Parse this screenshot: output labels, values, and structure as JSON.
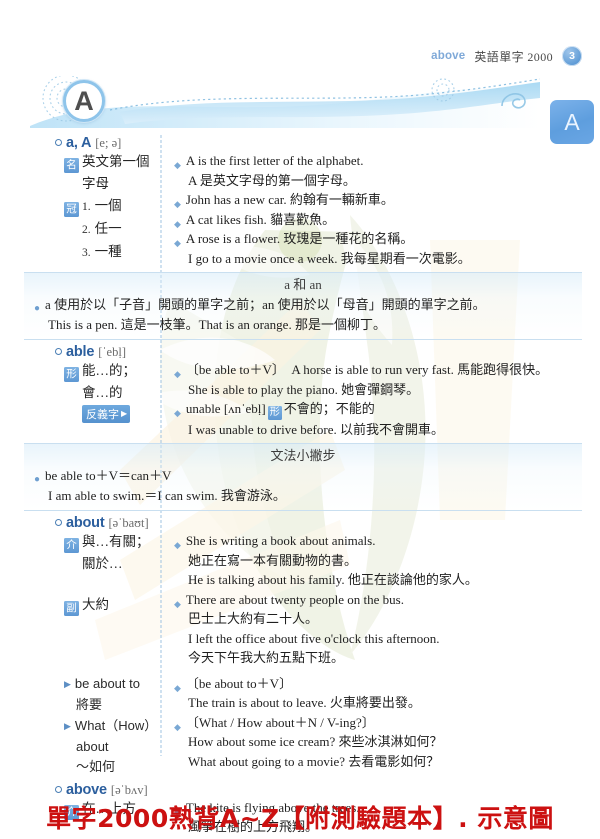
{
  "header": {
    "running_word": "above",
    "book_title": "英語單字 2000",
    "page_number": "3"
  },
  "thumb_tab": {
    "letter": "A"
  },
  "banner": {
    "letter": "A"
  },
  "colors": {
    "headword": "#2c5f9e",
    "pos_badge": "#5d97d3",
    "accent_blue": "#7aa8d4",
    "footer_red": "#cc1111"
  },
  "entries": [
    {
      "headword": "a, A",
      "phonetic": "[e; ə]",
      "senses": [
        {
          "pos": "名",
          "def_lines": [
            "英文第一個",
            "字母"
          ],
          "examples": [
            {
              "en": "A is the first letter of the alphabet.",
              "zh": "A 是英文字母的第一個字母。",
              "layout": "two-line"
            }
          ]
        },
        {
          "pos": "冠",
          "numbered": [
            "一個",
            "任一",
            "一種"
          ],
          "examples": [
            {
              "en": "John has a new car.",
              "zh": "約翰有一輛新車。",
              "layout": "inline"
            },
            {
              "en": "A cat likes fish.",
              "zh": "貓喜歡魚。",
              "layout": "inline"
            },
            {
              "en": "A rose is a flower.",
              "zh": "玫瑰是一種花的名稱。",
              "layout": "inline",
              "extra_en": "I go to a movie once a week.",
              "extra_zh": "我每星期看一次電影。"
            }
          ]
        }
      ],
      "note": {
        "title": "a 和 an",
        "bullet": "a 使用於以「子音」開頭的單字之前；an 使用於以「母音」開頭的單字之前。",
        "continuation": "This is a pen. 這是一枝筆。That is an orange. 那是一個柳丁。"
      }
    },
    {
      "headword": "able",
      "phonetic": "[ˈebḷ]",
      "senses": [
        {
          "pos": "形",
          "def_lines": [
            "能…的；",
            "會…的"
          ],
          "xref_label": "反義字",
          "examples": [
            {
              "pattern": "〔be able to＋V〕",
              "en": "A horse is able to run very fast.",
              "zh": "馬能跑得很快。",
              "layout": "pattern-inline",
              "extra_en": "She is able to play the piano.",
              "extra_zh": "她會彈鋼琴。"
            },
            {
              "antonym_word": "unable",
              "antonym_phon": "[ʌnˈebḷ]",
              "antonym_pos": "形",
              "antonym_def": "不會的；不能的",
              "extra_en": "I was unable to drive before.",
              "extra_zh": "以前我不會開車。",
              "layout": "antonym"
            }
          ]
        }
      ],
      "note": {
        "title": "文法小撇步",
        "bullet": "be able to＋V＝can＋V",
        "continuation": "I am able to swim.＝I can swim. 我會游泳。"
      }
    },
    {
      "headword": "about",
      "phonetic": "[əˈbaʊt]",
      "senses": [
        {
          "pos": "介",
          "def_lines": [
            "與…有關；",
            "關於…"
          ],
          "examples": [
            {
              "en": "She is writing a book about animals.",
              "zh": "她正在寫一本有關動物的書。",
              "layout": "two-line",
              "extra_en": "He is talking about his family.",
              "extra_zh": "他正在談論他的家人。"
            }
          ]
        },
        {
          "pos": "副",
          "def_lines": [
            "大約"
          ],
          "examples": [
            {
              "en": "There are about twenty people on the bus.",
              "zh": "巴士上大約有二十人。",
              "layout": "two-line",
              "extra_en": "I left the office about five o'clock this afternoon.",
              "extra_zh": "今天下午我大約五點下班。"
            }
          ]
        }
      ],
      "phrases": [
        {
          "phrase": "be about to",
          "phrase_zh": "將要",
          "examples": [
            {
              "pattern": "〔be about to＋V〕",
              "en": "The train is about to leave.",
              "zh": "火車將要出發。",
              "layout": "pattern-block"
            }
          ]
        },
        {
          "phrase": "What（How）",
          "phrase_line2": "about",
          "phrase_zh": "～如何",
          "examples": [
            {
              "pattern": "〔What / How about＋N / V-ing?〕",
              "en": "How about some ice cream?",
              "zh": "來些冰淇淋如何？",
              "layout": "pattern-block",
              "extra_en": "What about going to a movie?",
              "extra_zh": "去看電影如何？"
            }
          ]
        }
      ]
    },
    {
      "headword": "above",
      "phonetic": "[əˈbʌv]",
      "senses": [
        {
          "pos": "介",
          "def_lines": [
            "在…上方"
          ],
          "examples": [
            {
              "en": "The kite is flying above the trees.",
              "zh": "風箏在樹的上方飛翔。",
              "layout": "two-line"
            }
          ]
        }
      ]
    }
  ],
  "footer": {
    "caption": "單字2000熟背A~Z【附測驗題本】. 示意圖"
  }
}
